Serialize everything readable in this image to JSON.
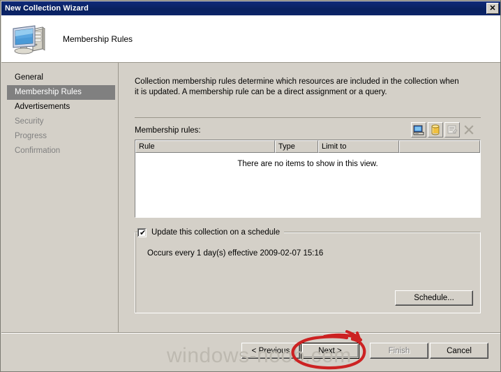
{
  "window": {
    "title": "New Collection Wizard",
    "close_label": "✕",
    "close_icon": "close-icon"
  },
  "header": {
    "title": "Membership Rules",
    "icon": "computer-icon"
  },
  "sidebar": {
    "items": [
      {
        "label": "General",
        "state": "normal"
      },
      {
        "label": "Membership Rules",
        "state": "active"
      },
      {
        "label": "Advertisements",
        "state": "normal"
      },
      {
        "label": "Security",
        "state": "disabled"
      },
      {
        "label": "Progress",
        "state": "disabled"
      },
      {
        "label": "Confirmation",
        "state": "disabled"
      }
    ]
  },
  "main": {
    "description": "Collection membership rules determine which resources are included in the collection when it is updated. A membership rule can be a direct assignment or a query.",
    "rules_label": "Membership rules:",
    "toolbar": [
      {
        "name": "direct-rule-icon",
        "enabled": true
      },
      {
        "name": "query-rule-icon",
        "enabled": true
      },
      {
        "name": "properties-icon",
        "enabled": false
      },
      {
        "name": "delete-icon",
        "enabled": false
      }
    ],
    "list": {
      "columns": [
        "Rule",
        "Type",
        "Limit to",
        ""
      ],
      "rows": [],
      "empty_message": "There are no items to show in this view."
    },
    "schedule": {
      "checkbox_label": "Update this collection on a schedule",
      "checked": true,
      "occurs_text": "Occurs every 1 day(s) effective 2009-02-07 15:16",
      "schedule_button": "Schedule..."
    }
  },
  "footer": {
    "buttons": [
      {
        "label": "< Previous",
        "state": "normal"
      },
      {
        "label": "Next >",
        "state": "default"
      },
      {
        "label": "Finish",
        "state": "disabled"
      },
      {
        "label": "Cancel",
        "state": "normal"
      }
    ]
  },
  "watermark": {
    "text": "windows-noob.com"
  },
  "annotation": {
    "color": "#cc2222",
    "shape": "hand-drawn-circle-around-next-button"
  }
}
